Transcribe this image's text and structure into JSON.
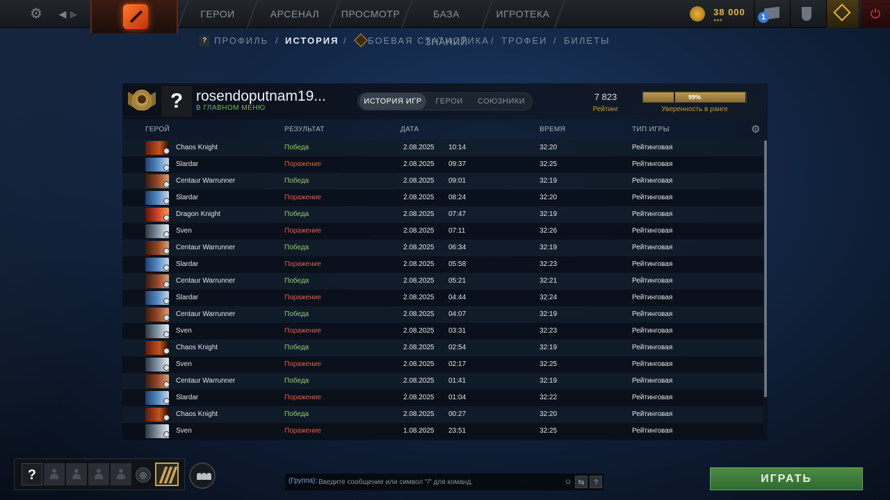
{
  "topbar": {
    "nav": [
      "ГЕРОИ",
      "АРСЕНАЛ",
      "ПРОСМОТР",
      "БАЗА ЗНАНИЙ",
      "ИГРОТЕКА"
    ],
    "gold": "38 000",
    "notification_count": "1"
  },
  "subnav": {
    "help_mark": "?",
    "items": [
      "ПРОФИЛЬ",
      "ИСТОРИЯ",
      "БОЕВАЯ СТАТИСТИКА",
      "ТРОФЕИ",
      "БИЛЕТЫ"
    ],
    "active": "ИСТОРИЯ"
  },
  "profile": {
    "avatar_mark": "?",
    "name": "rosendoputnam19...",
    "status": "В ГЛАВНОМ МЕНЮ",
    "tabs": [
      "ИСТОРИЯ ИГР",
      "ГЕРОИ",
      "СОЮЗНИКИ"
    ],
    "rating_value": "7 823",
    "rating_label": "Рейтинг",
    "confidence_value": "99%",
    "confidence_fraction": 0.99,
    "confidence_label": "Уверенность в ранге"
  },
  "table": {
    "headers": [
      "ГЕРОЙ",
      "РЕЗУЛЬТАТ",
      "ДАТА",
      "ВРЕМЯ",
      "ТИП ИГРЫ"
    ],
    "rows": [
      {
        "hero": "Chaos Knight",
        "result": "Победа",
        "date": "2.08.2025",
        "time": "10:14",
        "duration": "32:20",
        "type": "Рейтинговая"
      },
      {
        "hero": "Slardar",
        "result": "Поражение",
        "date": "2.08.2025",
        "time": "09:37",
        "duration": "32:25",
        "type": "Рейтинговая"
      },
      {
        "hero": "Centaur Warrunner",
        "result": "Победа",
        "date": "2.08.2025",
        "time": "09:01",
        "duration": "32:19",
        "type": "Рейтинговая"
      },
      {
        "hero": "Slardar",
        "result": "Поражение",
        "date": "2.08.2025",
        "time": "08:24",
        "duration": "32:20",
        "type": "Рейтинговая"
      },
      {
        "hero": "Dragon Knight",
        "result": "Победа",
        "date": "2.08.2025",
        "time": "07:47",
        "duration": "32:19",
        "type": "Рейтинговая"
      },
      {
        "hero": "Sven",
        "result": "Поражение",
        "date": "2.08.2025",
        "time": "07:11",
        "duration": "32:26",
        "type": "Рейтинговая"
      },
      {
        "hero": "Centaur Warrunner",
        "result": "Победа",
        "date": "2.08.2025",
        "time": "06:34",
        "duration": "32:19",
        "type": "Рейтинговая"
      },
      {
        "hero": "Slardar",
        "result": "Поражение",
        "date": "2.08.2025",
        "time": "05:58",
        "duration": "32:23",
        "type": "Рейтинговая"
      },
      {
        "hero": "Centaur Warrunner",
        "result": "Победа",
        "date": "2.08.2025",
        "time": "05:21",
        "duration": "32:21",
        "type": "Рейтинговая"
      },
      {
        "hero": "Slardar",
        "result": "Поражение",
        "date": "2.08.2025",
        "time": "04:44",
        "duration": "32:24",
        "type": "Рейтинговая"
      },
      {
        "hero": "Centaur Warrunner",
        "result": "Победа",
        "date": "2.08.2025",
        "time": "04:07",
        "duration": "32:19",
        "type": "Рейтинговая"
      },
      {
        "hero": "Sven",
        "result": "Поражение",
        "date": "2.08.2025",
        "time": "03:31",
        "duration": "32:23",
        "type": "Рейтинговая"
      },
      {
        "hero": "Chaos Knight",
        "result": "Победа",
        "date": "2.08.2025",
        "time": "02:54",
        "duration": "32:19",
        "type": "Рейтинговая"
      },
      {
        "hero": "Sven",
        "result": "Поражение",
        "date": "2.08.2025",
        "time": "02:17",
        "duration": "32:25",
        "type": "Рейтинговая"
      },
      {
        "hero": "Centaur Warrunner",
        "result": "Победа",
        "date": "2.08.2025",
        "time": "01:41",
        "duration": "32:19",
        "type": "Рейтинговая"
      },
      {
        "hero": "Slardar",
        "result": "Поражение",
        "date": "2.08.2025",
        "time": "01:04",
        "duration": "32:22",
        "type": "Рейтинговая"
      },
      {
        "hero": "Chaos Knight",
        "result": "Победа",
        "date": "2.08.2025",
        "time": "00:27",
        "duration": "32:20",
        "type": "Рейтинговая"
      },
      {
        "hero": "Sven",
        "result": "Поражение",
        "date": "1.08.2025",
        "time": "23:51",
        "duration": "32:25",
        "type": "Рейтинговая"
      }
    ]
  },
  "bottom": {
    "party_me_mark": "?",
    "chat_channel": "(Группа):",
    "chat_placeholder": "Введите сообщение или символ \"/\" для команд.",
    "chat_help_mark": "?",
    "play_label": "ИГРАТЬ"
  },
  "colors": {
    "win": "#8fd16a",
    "loss": "#e85a4a",
    "gold": "#e1b84a",
    "play_green": "#3f7c3a",
    "rank_label": "#c69a3d"
  },
  "icons": [
    "settings-gear-icon",
    "back-arrow-icon",
    "forward-arrow-icon",
    "dota-logo-icon",
    "gold-coin-icon",
    "mail-icon",
    "armory-icon",
    "plus-bundle-icon",
    "power-icon",
    "help-icon",
    "plus-hex-icon",
    "rank-medal-icon",
    "table-settings-icon",
    "voice-icon",
    "rank-emblem-icon",
    "friends-icon",
    "smiley-icon",
    "chat-wheel-icon",
    "hero-portrait-icon",
    "role-icon"
  ]
}
